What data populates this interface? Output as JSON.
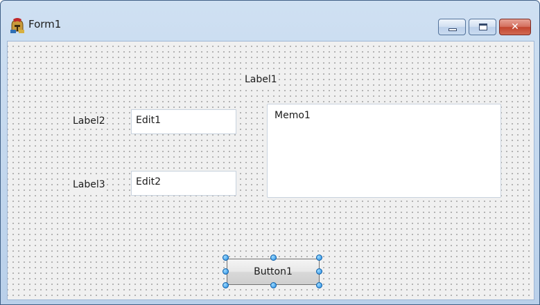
{
  "window": {
    "title": "Form1",
    "app_icon": "spartan-helmet-icon",
    "caption_buttons": [
      "minimize-icon",
      "maximize-icon",
      "close-icon"
    ]
  },
  "form": {
    "label1": "Label1",
    "label2": "Label2",
    "label3": "Label3",
    "edit1": "Edit1",
    "edit2": "Edit2",
    "memo1": "Memo1",
    "button1": "Button1"
  },
  "colors": {
    "selection_handle": "#1e86e0",
    "form_background": "#f0f0f0",
    "close_button": "#c2452f"
  }
}
